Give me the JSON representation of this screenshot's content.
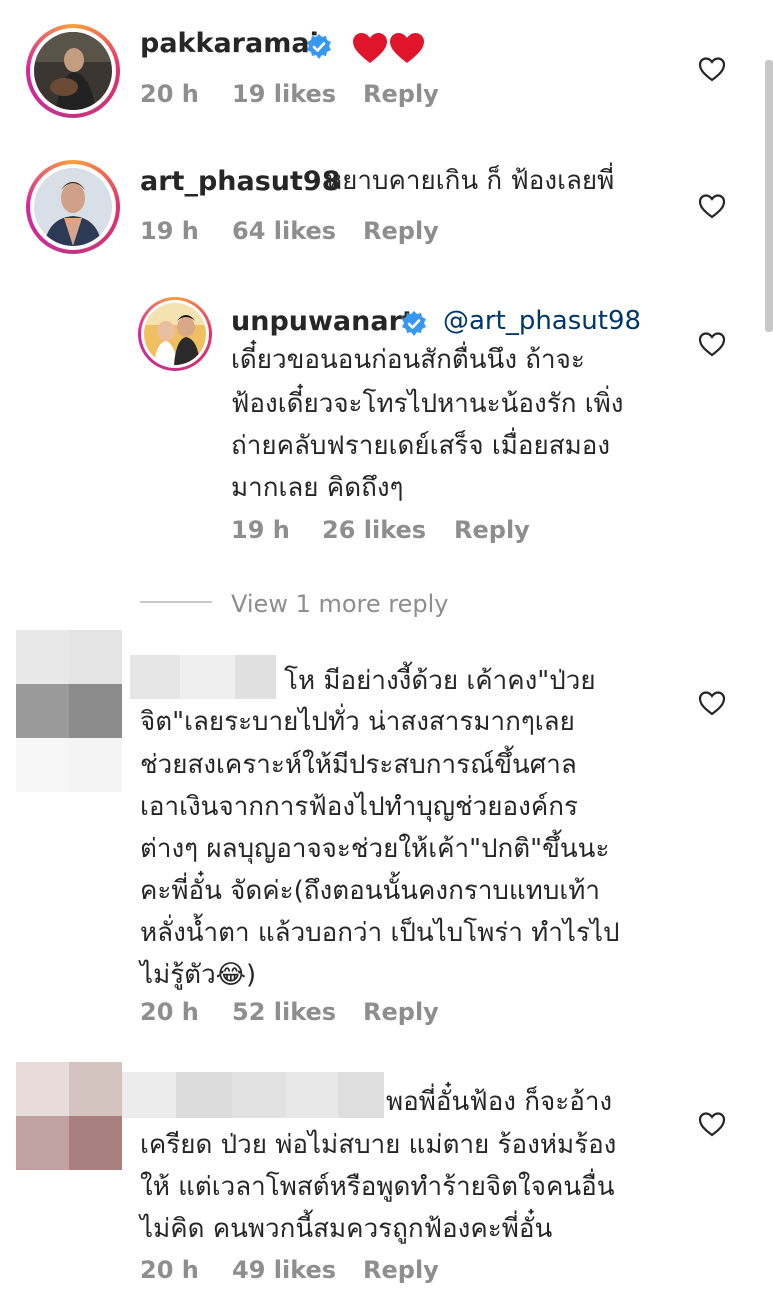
{
  "comments": [
    {
      "username": "pakkaramai",
      "emoji": "❤️❤️",
      "time": "20 h",
      "likes": "19 likes",
      "reply": "Reply"
    },
    {
      "username": "art_phasut98",
      "text": "หยาบคายเกิน ก็ ฟ้องเลยพี่",
      "time": "19 h",
      "likes": "64 likes",
      "reply": "Reply"
    },
    {
      "username": "unpuwanart",
      "mention": "@art_phasut98",
      "lines": [
        "เดี๋ยวขอนอนก่อนสักตื่นนึง ถ้าจะ",
        "ฟ้องเดี๋ยวจะโทรไปหานะน้องรัก เพิ่ง",
        "ถ่ายคลับฟรายเดย์เสร็จ เมื่อยสมอง",
        "มากเลย คิดถึงๆ"
      ],
      "time": "19 h",
      "likes": "26 likes",
      "reply": "Reply"
    },
    {
      "first_line": "โห มีอย่างงี้ด้วย เค้าคง\"ป่วย",
      "lines": [
        "จิต\"เลยระบายไปทั่ว น่าสงสารมากๆเลย",
        "ช่วยสงเคราะห์ให้มีประสบการณ์ขึ้นศาล",
        "เอาเงินจากการฟ้องไปทำบุญช่วยองค์กร",
        "ต่างๆ ผลบุญอาจจะช่วยให้เค้า\"ปกติ\"ขึ้นนะ",
        "คะพี่อั๋น จัดค่ะ(ถึงตอนนั้นคงกราบแทบเท้า",
        "หลั่งน้ำตา แล้วบอกว่า เป็นไบโพร่า ทำไรไป",
        "ไม่รู้ตัว😂)"
      ],
      "time": "20 h",
      "likes": "52 likes",
      "reply": "Reply"
    },
    {
      "first_line": "พอพี่อั๋นฟ้อง ก็จะอ้าง",
      "lines": [
        "เครียด ป่วย พ่อไม่สบาย แม่ตาย ร้องห่มร้อง",
        "ให้  แต่เวลาโพสต์หรือพูดทำร้ายจิตใจคนอื่น",
        "ไม่คิด คนพวกนี้สมควรถูกฟ้องคะพี่อั๋น"
      ],
      "time": "20 h",
      "likes": "49 likes",
      "reply": "Reply"
    }
  ],
  "view_more": "View 1 more reply",
  "colors": {
    "text": "#262626",
    "meta": "#8e8e8e",
    "mention": "#00376b",
    "verified": "#3897f0",
    "heart": "#e0142b"
  },
  "icons": [
    "verified-badge-icon",
    "heart-icon",
    "like-heart-outline-icon"
  ]
}
